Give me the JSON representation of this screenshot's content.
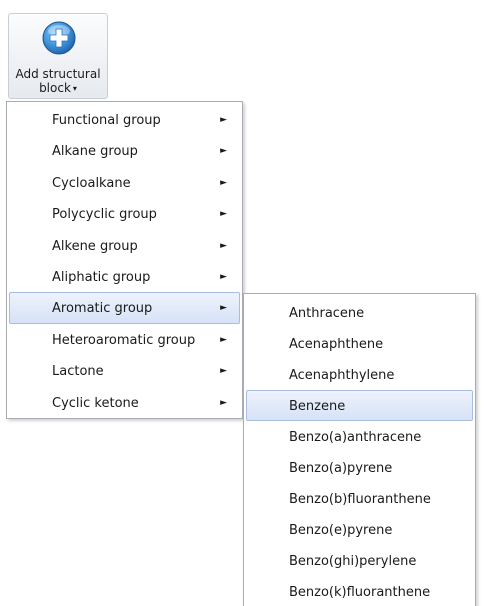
{
  "ribbon": {
    "button_label_line1": "Add structural",
    "button_label_line2": "block",
    "dropdown_arrow": "▾",
    "icon": "plus-icon"
  },
  "menu": {
    "submenu_arrow": "►",
    "items": [
      {
        "label": "Functional group"
      },
      {
        "label": "Alkane group"
      },
      {
        "label": "Cycloalkane"
      },
      {
        "label": "Polycyclic group"
      },
      {
        "label": "Alkene group"
      },
      {
        "label": "Aliphatic group"
      },
      {
        "label": "Aromatic group",
        "highlighted": true
      },
      {
        "label": "Heteroaromatic group"
      },
      {
        "label": "Lactone"
      },
      {
        "label": "Cyclic ketone"
      }
    ]
  },
  "submenu": {
    "items": [
      {
        "label": "Anthracene"
      },
      {
        "label": "Acenaphthene"
      },
      {
        "label": "Acenaphthylene"
      },
      {
        "label": "Benzene",
        "highlighted": true
      },
      {
        "label": "Benzo(a)anthracene"
      },
      {
        "label": "Benzo(a)pyrene"
      },
      {
        "label": "Benzo(b)fluoranthene"
      },
      {
        "label": "Benzo(e)pyrene"
      },
      {
        "label": "Benzo(ghi)perylene"
      },
      {
        "label": "Benzo(k)fluoranthene"
      }
    ]
  },
  "colors": {
    "highlight_top": "#eef3fc",
    "highlight_bottom": "#d6e2f7",
    "highlight_border": "#a9bde0",
    "icon_blue": "#3a8fd6"
  }
}
